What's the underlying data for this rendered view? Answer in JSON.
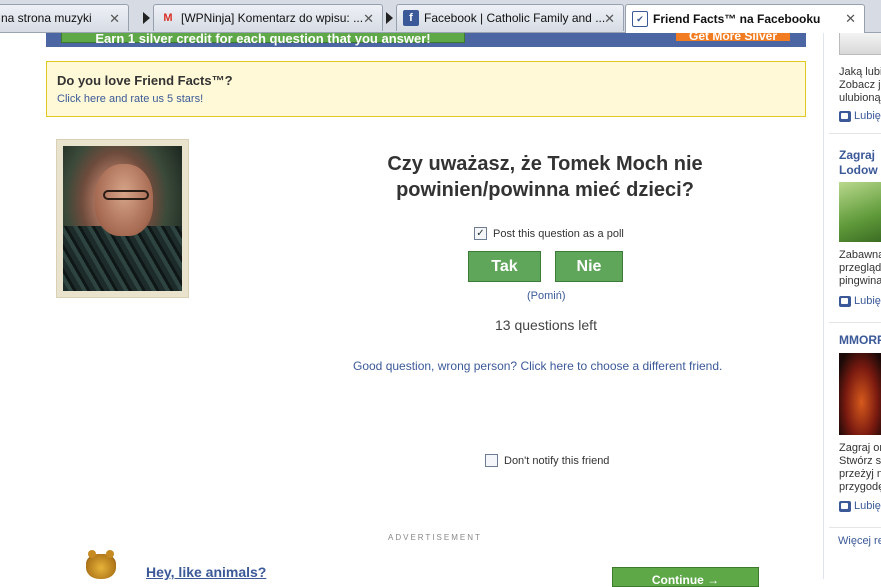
{
  "tabs": [
    {
      "title": "na strona muzyki",
      "icon": "none"
    },
    {
      "title": "[WPNinja] Komentarz do wpisu: ...",
      "icon": "gmail-icon"
    },
    {
      "title": "Facebook | Catholic Family and ...",
      "icon": "facebook-icon"
    },
    {
      "title": "Friend Facts™ na Facebooku",
      "icon": "friend-facts-icon"
    }
  ],
  "earn_banner": {
    "credit_text": "Earn 1 silver credit for each question that you answer!",
    "more_text": "Get More Silver"
  },
  "love_box": {
    "title": "Do you love Friend Facts™?",
    "link": "Click here and rate us 5 stars!"
  },
  "question": {
    "text": "Czy uważasz, że Tomek Moch nie powinien/powinna mieć dzieci?",
    "poll_label": "Post this question as a poll",
    "poll_checked": true,
    "yes_label": "Tak",
    "no_label": "Nie",
    "skip_label": "(Pomiń)",
    "remaining": "13 questions left",
    "wrong_person": "Good question, wrong person? Click here to choose a different friend.",
    "notify_label": "Don't notify this friend",
    "notify_checked": false
  },
  "ad": {
    "label": "ADVERTISEMENT",
    "headline": "Hey, like animals?",
    "button": "Continue →"
  },
  "sidebar": {
    "block1_text": "Jaką lubisz Zobacz ja ulubioną",
    "like": "Lubię",
    "block2_title_1": "Zagraj",
    "block2_title_2": "Lodow",
    "block2_text": "Zabawna przegląda pingwina",
    "block3_title": "MMORP",
    "block3_text": "Zagraj on Stwórz sw przeżyj n przygodę",
    "more": "Więcej re"
  }
}
